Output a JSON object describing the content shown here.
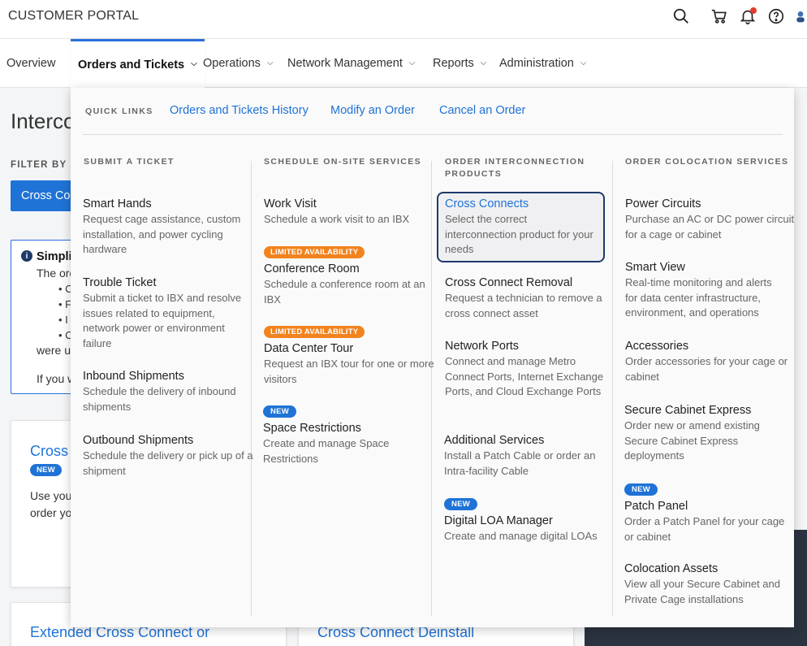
{
  "header": {
    "brand": "CUSTOMER PORTAL",
    "icons": [
      "search-icon",
      "cart-icon",
      "bell-icon",
      "help-icon",
      "avatar"
    ]
  },
  "nav": {
    "items": [
      {
        "label": "Overview"
      },
      {
        "label": "Orders and Tickets"
      },
      {
        "label": "Operations"
      },
      {
        "label": "Network Management"
      },
      {
        "label": "Reports"
      },
      {
        "label": "Administration"
      }
    ]
  },
  "background": {
    "page_title": "Interco",
    "filter_label": "FILTER BY C",
    "primary_button": "Cross Co",
    "info": {
      "title": "Simpli",
      "line1": "The ord",
      "bullets": [
        "C",
        "F",
        "I",
        "C"
      ],
      "line2": "were u",
      "line3": "If you w"
    },
    "card1": {
      "title": "Cross",
      "badge": "NEW",
      "line1": "Use you",
      "line2": "order yo"
    },
    "card2": {
      "title": "Extended Cross Connect or"
    },
    "card3": {
      "title": "Cross Connect Deinstall"
    }
  },
  "mega": {
    "quick_links_label": "QUICK LINKS",
    "quick_links": [
      "Orders and Tickets History",
      "Modify an Order",
      "Cancel an Order"
    ],
    "columns": [
      {
        "heading": "SUBMIT A TICKET",
        "items": [
          {
            "title": "Smart Hands",
            "desc": "Request cage assistance, custom installation, and power cycling hardware"
          },
          {
            "title": "Trouble Ticket",
            "desc": "Submit a ticket to IBX and resolve issues related to equipment, network power or environment failure"
          },
          {
            "title": "Inbound Shipments",
            "desc": "Schedule the delivery of inbound shipments"
          },
          {
            "title": "Outbound Shipments",
            "desc": "Schedule the delivery or pick up of a shipment"
          }
        ]
      },
      {
        "heading": "SCHEDULE ON-SITE SERVICES",
        "items": [
          {
            "title": "Work Visit",
            "desc": "Schedule a work visit to an IBX"
          },
          {
            "badge": "LIMITED AVAILABILITY",
            "title": "Conference Room",
            "desc": "Schedule a conference room at an IBX"
          },
          {
            "badge": "LIMITED AVAILABILITY",
            "title": "Data Center Tour",
            "desc": "Request an IBX tour for one or more visitors"
          },
          {
            "badge": "NEW",
            "title": "Space Restrictions",
            "desc": "Create and manage Space Restrictions"
          }
        ]
      },
      {
        "heading": "ORDER INTERCONNECTION PRODUCTS",
        "items": [
          {
            "title": "Cross Connects",
            "desc": "Select the correct interconnection product for your needs"
          },
          {
            "title": "Cross Connect Removal",
            "desc": "Request a technician to remove a cross connect asset"
          },
          {
            "title": "Network Ports",
            "desc": "Connect and manage Metro Connect Ports, Internet Exchange Ports, and Cloud Exchange Ports"
          },
          {
            "title": "Additional Services",
            "desc": "Install a Patch Cable or order an Intra-facility Cable"
          },
          {
            "badge": "NEW",
            "title": "Digital LOA Manager",
            "desc": "Create and manage digital LOAs"
          }
        ]
      },
      {
        "heading": "ORDER COLOCATION SERVICES",
        "items": [
          {
            "title": "Power Circuits",
            "desc": "Purchase an AC or DC power circuit for a cage or cabinet"
          },
          {
            "title": "Smart View",
            "desc": "Real-time monitoring and alerts for data center infrastructure, environment, and operations"
          },
          {
            "title": "Accessories",
            "desc": "Order accessories for your cage or cabinet"
          },
          {
            "title": "Secure Cabinet Express",
            "desc": "Order new or amend existing Secure Cabinet Express deployments"
          },
          {
            "badge": "NEW",
            "title": "Patch Panel",
            "desc": "Order a Patch Panel for your cage or cabinet"
          },
          {
            "title": "Colocation Assets",
            "desc": "View all your Secure Cabinet and Private Cage installations"
          }
        ]
      }
    ]
  },
  "colors": {
    "accent": "#1f73d6",
    "badge_orange": "#f2831f",
    "selected_border": "#1e3a6b",
    "alert_dot": "#e23b2e"
  }
}
